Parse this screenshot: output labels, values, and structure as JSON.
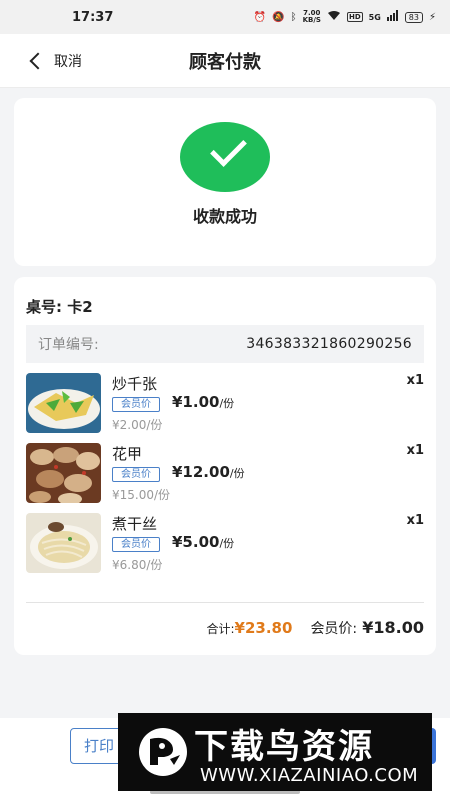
{
  "status": {
    "time": "17:37",
    "net_speed_value": "7.00",
    "net_speed_unit": "KB/S",
    "hd": "HD",
    "signal": "5G",
    "battery": "83"
  },
  "nav": {
    "back_label": "取消",
    "title": "顾客付款"
  },
  "success": {
    "text": "收款成功",
    "icon": "check-icon",
    "color": "#1fbe5a"
  },
  "order": {
    "table_label": "桌号: 卡2",
    "order_no_label": "订单编号:",
    "order_no": "346383321860290256",
    "items": [
      {
        "name": "炒千张",
        "tag": "会员价",
        "member_price": "¥1.00",
        "unit": "/份",
        "orig_price": "¥2.00/份",
        "qty": "x1"
      },
      {
        "name": "花甲",
        "tag": "会员价",
        "member_price": "¥12.00",
        "unit": "/份",
        "orig_price": "¥15.00/份",
        "qty": "x1"
      },
      {
        "name": "煮干丝",
        "tag": "会员价",
        "member_price": "¥5.00",
        "unit": "/份",
        "orig_price": "¥6.80/份",
        "qty": "x1"
      }
    ],
    "total_label": "合计:",
    "total_value": "¥23.80",
    "member_total_label": "会员价:",
    "member_total_value": "¥18.00"
  },
  "bottom": {
    "print_label": "打印"
  },
  "watermark": {
    "title": "下载鸟资源",
    "url": "WWW.XIAZAINIAO.COM"
  },
  "colors": {
    "accent": "#3b74d8",
    "total": "#e07a1a"
  }
}
